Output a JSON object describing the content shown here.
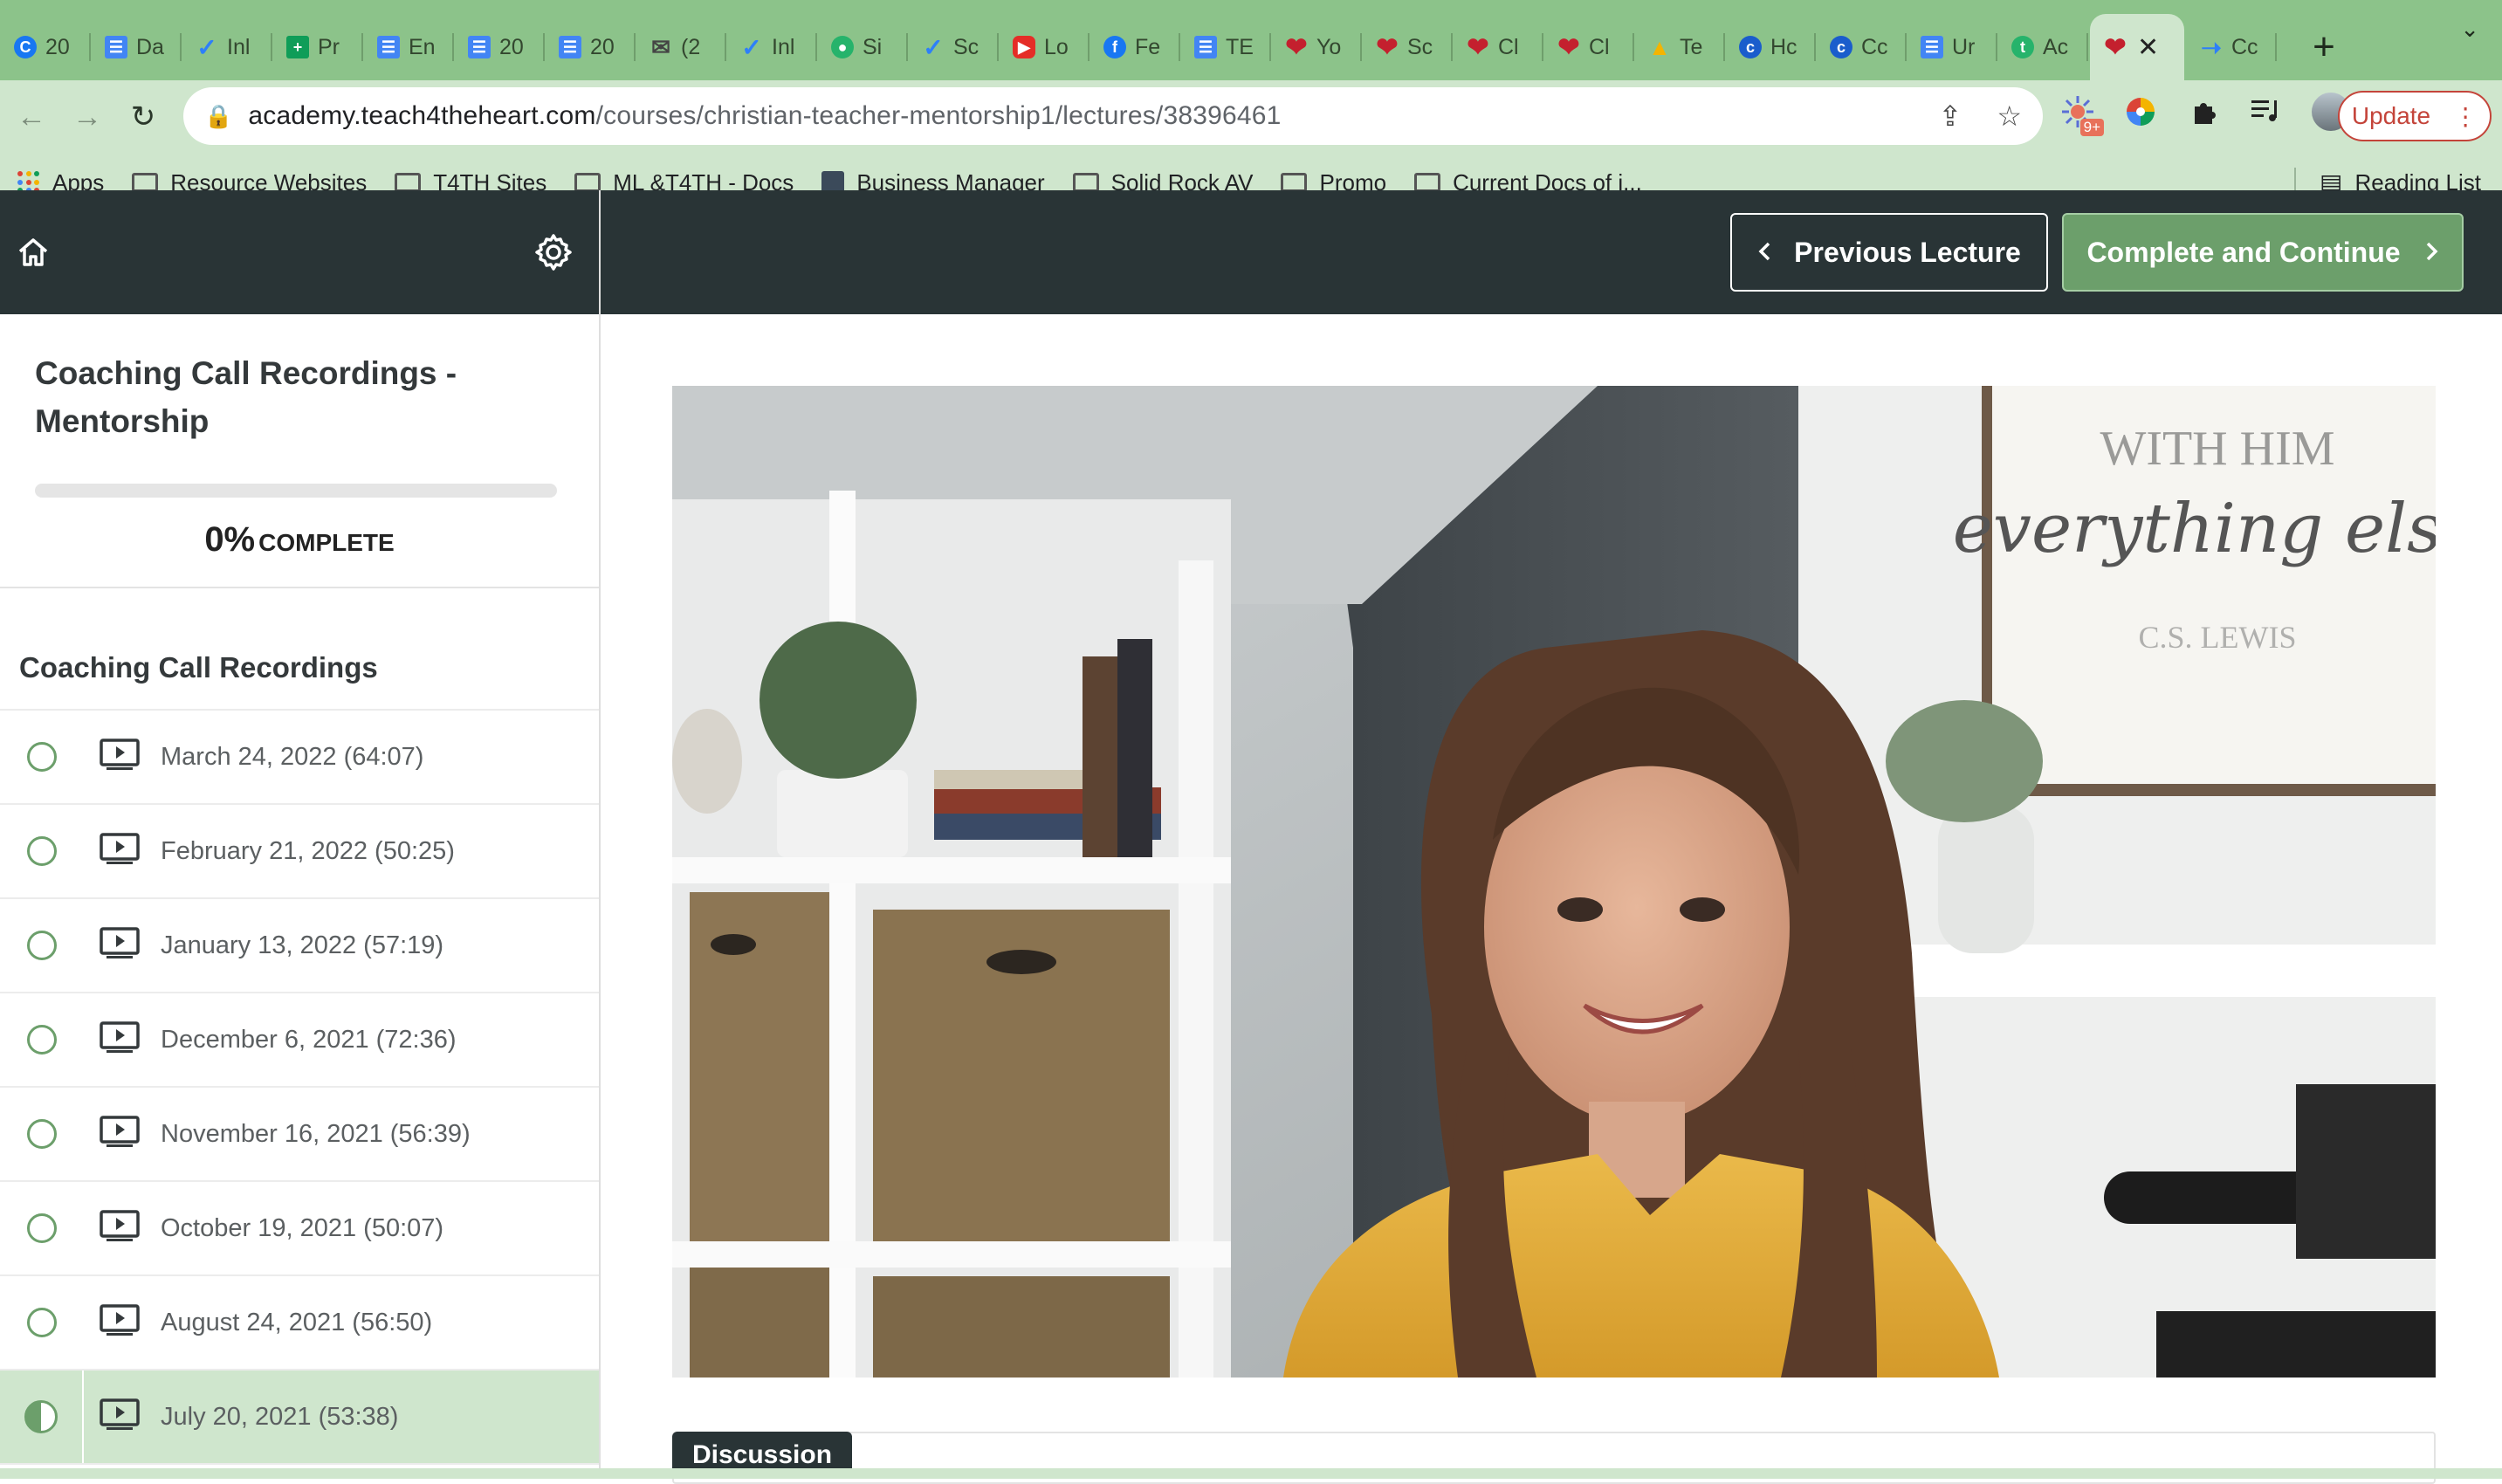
{
  "browser": {
    "tabs": [
      {
        "label": "20",
        "icon": "gear-c-icon"
      },
      {
        "label": "Da",
        "icon": "doc-icon"
      },
      {
        "label": "Inl",
        "icon": "blue-check-icon"
      },
      {
        "label": "Pr",
        "icon": "sheet-icon"
      },
      {
        "label": "En",
        "icon": "doc-icon"
      },
      {
        "label": "20",
        "icon": "doc-icon"
      },
      {
        "label": "20",
        "icon": "doc-icon"
      },
      {
        "label": "(2",
        "icon": "mail-icon"
      },
      {
        "label": "Inl",
        "icon": "blue-check-icon"
      },
      {
        "label": "Si",
        "icon": "green-circle-icon"
      },
      {
        "label": "Sc",
        "icon": "blue-check-icon"
      },
      {
        "label": "Lo",
        "icon": "youtube-icon"
      },
      {
        "label": "Fe",
        "icon": "facebook-icon"
      },
      {
        "label": "TE",
        "icon": "doc-icon"
      },
      {
        "label": "Yo",
        "icon": "heart-icon"
      },
      {
        "label": "Sc",
        "icon": "heart-icon"
      },
      {
        "label": "Cl",
        "icon": "heart-icon"
      },
      {
        "label": "Cl",
        "icon": "heart-icon"
      },
      {
        "label": "Te",
        "icon": "drive-icon"
      },
      {
        "label": "Hc",
        "icon": "circle-c-icon"
      },
      {
        "label": "Cc",
        "icon": "circle-c-icon"
      },
      {
        "label": "Ur",
        "icon": "doc-icon"
      },
      {
        "label": "Ac",
        "icon": "t-icon"
      }
    ],
    "active_tab_icon": "heart-icon",
    "trailing_tab": {
      "label": "Cc",
      "icon": "blue-wing-icon"
    },
    "url_domain": "academy.teach4theheart.com",
    "url_path": "/courses/christian-teacher-mentorship1/lectures/38396461",
    "extension_badge": "9+",
    "update_label": "Update",
    "bookmarks": [
      "Apps",
      "Resource Websites",
      "T4TH Sites",
      "ML &T4TH - Docs",
      "Business Manager",
      "Solid Rock AV",
      "Promo",
      "Current Docs of i..."
    ],
    "reading_list": "Reading List"
  },
  "course": {
    "title": "Coaching Call Recordings - Mentorship",
    "progress_value": 0,
    "progress_percent": "0%",
    "progress_label": "COMPLETE",
    "section_title": "Coaching Call Recordings",
    "lectures": [
      {
        "label": "March 24, 2022 (64:07)",
        "status": "incomplete"
      },
      {
        "label": "February 21, 2022 (50:25)",
        "status": "incomplete"
      },
      {
        "label": "January 13, 2022 (57:19)",
        "status": "incomplete"
      },
      {
        "label": "December 6, 2021 (72:36)",
        "status": "incomplete"
      },
      {
        "label": "November 16, 2021 (56:39)",
        "status": "incomplete"
      },
      {
        "label": "October 19, 2021 (50:07)",
        "status": "incomplete"
      },
      {
        "label": "August 24, 2021 (56:50)",
        "status": "incomplete"
      },
      {
        "label": "July 20, 2021 (53:38)",
        "status": "in-progress"
      }
    ]
  },
  "nav": {
    "prev_label": "Previous Lecture",
    "next_label": "Complete and Continue"
  },
  "video": {
    "sign_line1": "WITH HIM",
    "sign_line2": "everything else",
    "sign_line3": "C.S. LEWIS"
  },
  "discussion": {
    "tab_label": "Discussion"
  },
  "colors": {
    "accent": "#6c9f6b",
    "header": "#293436",
    "chrome": "#8cc38a",
    "active_row": "#cfe6cd"
  }
}
